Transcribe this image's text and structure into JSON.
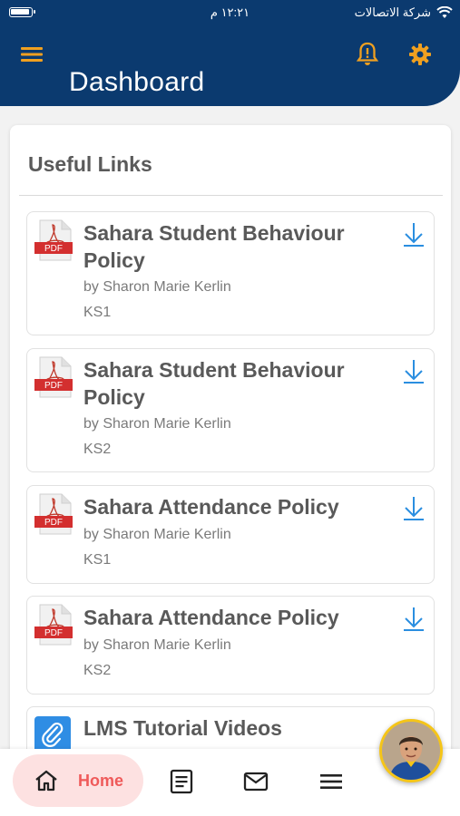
{
  "status_bar": {
    "time": "١٢:٢١ م",
    "carrier": "شركة الاتصالات"
  },
  "header": {
    "title": "Dashboard"
  },
  "useful_links": {
    "title": "Useful Links",
    "items": [
      {
        "title": "Sahara Student Behaviour Policy",
        "author": "by Sharon Marie Kerlin",
        "stage": "KS1",
        "type_label": "PDF"
      },
      {
        "title": "Sahara Student Behaviour Policy",
        "author": "by Sharon Marie Kerlin",
        "stage": "KS2",
        "type_label": "PDF"
      },
      {
        "title": "Sahara Attendance Policy",
        "author": "by Sharon Marie Kerlin",
        "stage": "KS1",
        "type_label": "PDF"
      },
      {
        "title": "Sahara Attendance Policy",
        "author": "by Sharon Marie Kerlin",
        "stage": "KS2",
        "type_label": "PDF"
      },
      {
        "title": "LMS Tutorial Videos"
      }
    ]
  },
  "bottom_nav": {
    "home_label": "Home"
  },
  "colors": {
    "header_bg": "#0b3a6f",
    "accent_orange": "#f0a020",
    "download_blue": "#2a8ee0",
    "home_pill": "#fde1e1",
    "home_text": "#ef5a5a"
  }
}
